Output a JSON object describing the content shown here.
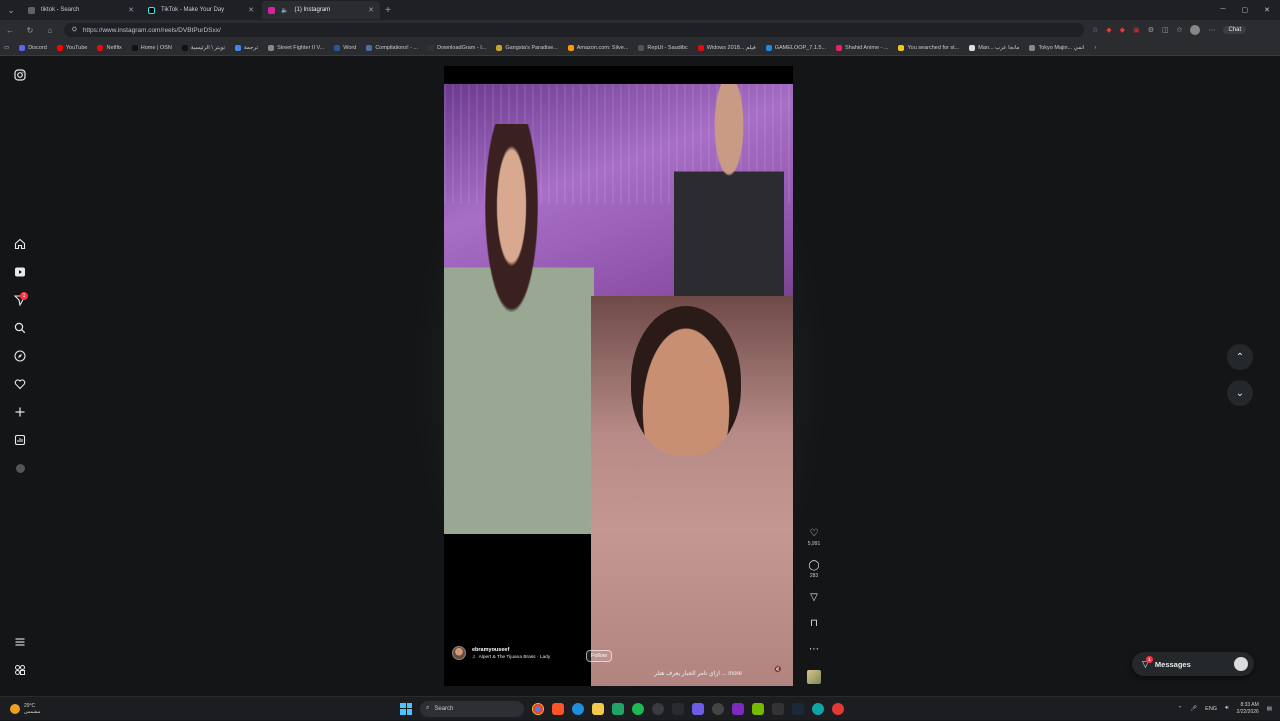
{
  "browser": {
    "tabs": [
      {
        "title": "tiktok - Search",
        "color": "#5f6368"
      },
      {
        "title": "TikTok - Make Your Day",
        "color": "#000000"
      },
      {
        "title": "(1) Instagram",
        "color": "#d6249f"
      }
    ],
    "url": "https://www.instagram.com/reels/DVBtPurDSxx/",
    "chat_label": "Chat",
    "bookmarks": [
      {
        "label": "Discord",
        "color": "#5865f2"
      },
      {
        "label": "YouTube",
        "color": "#ff0000"
      },
      {
        "label": "Netflix",
        "color": "#e50914"
      },
      {
        "label": "Home | OSN",
        "color": "#111111"
      },
      {
        "label": "تويتر \\ الرئيسية",
        "color": "#111111"
      },
      {
        "label": "ترجمة",
        "color": "#4285f4"
      },
      {
        "label": "Street Fighter II V...",
        "color": "#888888"
      },
      {
        "label": "Word",
        "color": "#2b579a"
      },
      {
        "label": "Compilations! - ...",
        "color": "#4a6fa5"
      },
      {
        "label": "DownloadGram - I...",
        "color": "#333333"
      },
      {
        "label": "Gangsta's Paradise...",
        "color": "#c9a227"
      },
      {
        "label": "Amazon.com: Silve...",
        "color": "#ff9900"
      },
      {
        "label": "RepUt - Saudibc",
        "color": "#555555"
      },
      {
        "label": "Widows 2018... فيلم",
        "color": "#e50914"
      },
      {
        "label": "GAMELOOP_7.1.5...",
        "color": "#1e88e5"
      },
      {
        "label": "Shahid Anime - ...",
        "color": "#e91e63"
      },
      {
        "label": "You searched for st...",
        "color": "#f5c518"
      },
      {
        "label": "Man... مانجا عرب",
        "color": "#dddddd"
      },
      {
        "label": "Tokyo Majin... انمي",
        "color": "#888888"
      }
    ]
  },
  "reel": {
    "username": "ebramyouseef",
    "audio": "Alpert & The Tijuana Brass · Lady",
    "follow_label": "Follow",
    "caption": "ازاي تامر الجبار يعرف هتلر ... more",
    "likes": "5,991",
    "comments": "283"
  },
  "sidebar": {
    "notification_count": "1"
  },
  "messages": {
    "label": "Messages",
    "badge": "1"
  },
  "taskbar": {
    "temp": "29°C",
    "weather_desc": "مشمس",
    "search_label": "Search",
    "lang": "ENG",
    "time": "8:33 AM",
    "date": "2/22/2026"
  }
}
